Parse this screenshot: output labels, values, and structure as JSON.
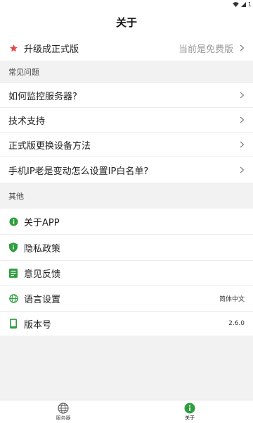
{
  "status": {
    "battery": "1"
  },
  "header": {
    "title": "关于"
  },
  "upgrade": {
    "label": "升级成正式版",
    "value": "当前是免费版",
    "icon": "star-icon"
  },
  "faq": {
    "section_title": "常见问题",
    "items": [
      {
        "label": "如何监控服务器?"
      },
      {
        "label": "技术支持"
      },
      {
        "label": "正式版更换设备方法"
      },
      {
        "label": "手机IP老是变动怎么设置IP白名单?"
      }
    ]
  },
  "other": {
    "section_title": "其他",
    "items": [
      {
        "label": "关于APP",
        "icon": "info-icon"
      },
      {
        "label": "隐私政策",
        "icon": "shield-icon"
      },
      {
        "label": "意见反馈",
        "icon": "feedback-icon"
      },
      {
        "label": "语言设置",
        "icon": "globe-icon",
        "value": "简体中文"
      },
      {
        "label": "版本号",
        "icon": "phone-icon",
        "value": "2.6.0"
      }
    ]
  },
  "tabbar": {
    "tabs": [
      {
        "label": "服务器",
        "icon": "globe-icon",
        "active": false
      },
      {
        "label": "关于",
        "icon": "info-icon",
        "active": true
      }
    ]
  },
  "colors": {
    "accent": "#2e9e3e",
    "star": "#e24a4a",
    "chevron": "#888888"
  }
}
